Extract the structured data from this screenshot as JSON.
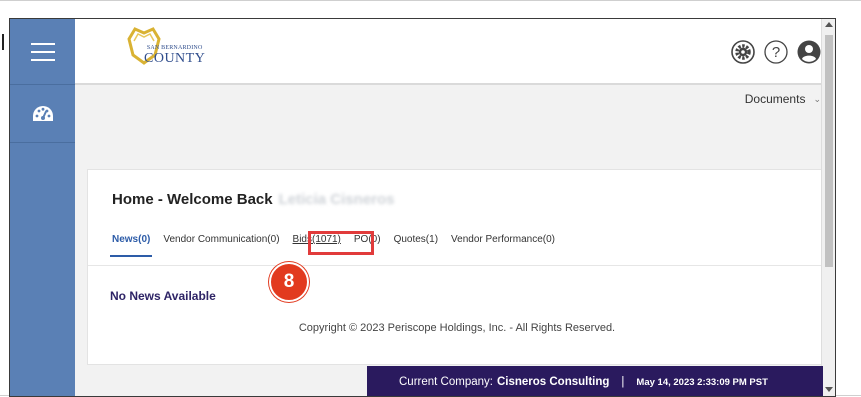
{
  "app": {
    "logo_small": "SAN BERNARDINO",
    "logo_big": "COUNTY"
  },
  "icons": {
    "menu": "hamburger-icon",
    "dashboard": "dashboard-gauge-icon",
    "settings": "gear-icon",
    "help": "question-circle-icon",
    "profile": "user-avatar-icon"
  },
  "header": {
    "documents_label": "Documents"
  },
  "home": {
    "welcome": "Home - Welcome Back",
    "user_name": "Leticia Cisneros",
    "tabs": [
      {
        "label": "News(0)",
        "active": true
      },
      {
        "label": "Vendor Communication(0)",
        "active": false
      },
      {
        "label": "Bids(1071)",
        "active": false
      },
      {
        "label": "PO(0)",
        "active": false
      },
      {
        "label": "Quotes(1)",
        "active": false
      },
      {
        "label": "Vendor Performance(0)",
        "active": false
      }
    ],
    "empty_message": "No News Available",
    "copyright": "Copyright © 2023 Periscope Holdings, Inc. - All Rights Reserved."
  },
  "annotation": {
    "step_number": "8"
  },
  "status": {
    "company_prefix": "Current Company:",
    "company_name": "Cisneros Consulting",
    "separator": "|",
    "datetime": "May 14, 2023 2:33:09 PM PST"
  },
  "colors": {
    "sidebar": "#5a80b5",
    "accent": "#2d5ca8",
    "statusbar": "#2a1a5e",
    "highlight": "#e13b3b"
  }
}
